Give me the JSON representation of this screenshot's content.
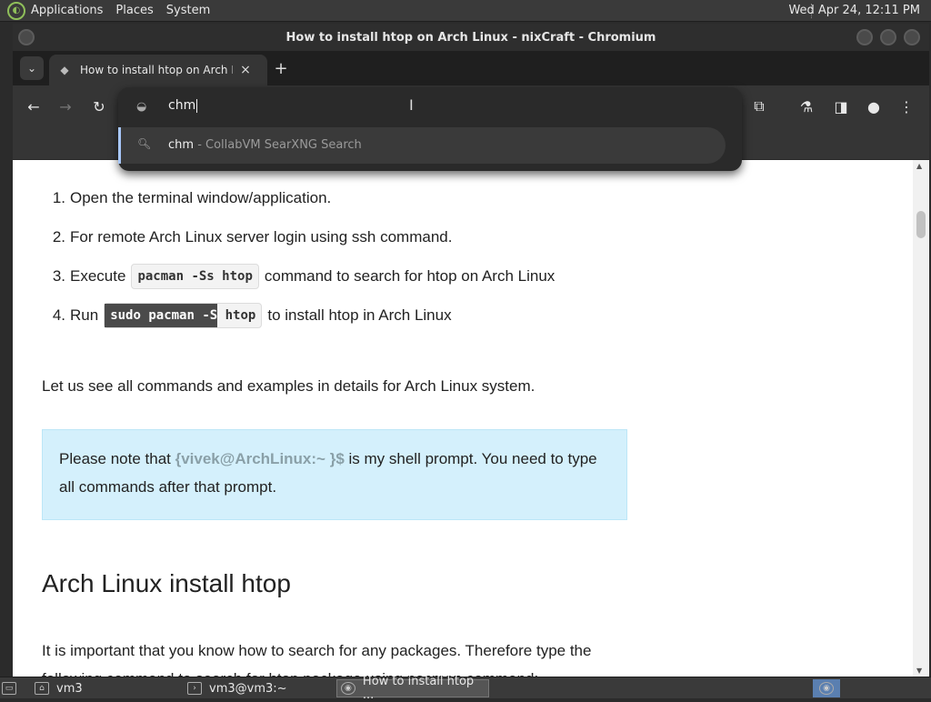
{
  "top_panel": {
    "menus": [
      "Applications",
      "Places",
      "System"
    ],
    "clock": "Wed Apr 24, 12:11 PM"
  },
  "window": {
    "title": "How to install htop on Arch Linux - nixCraft - Chromium"
  },
  "tab": {
    "title": "How to install htop on Arch L",
    "close": "×",
    "new_tab": "+"
  },
  "omnibox": {
    "query": "chm",
    "suggestion": {
      "term": "chm",
      "source": " - CollabVM SearXNG Search"
    }
  },
  "content": {
    "steps": [
      {
        "num": "1.",
        "text": "Open the terminal window/application."
      },
      {
        "num": "2.",
        "text": "For remote Arch Linux server login using ssh command."
      },
      {
        "num": "3.",
        "pre": "Execute",
        "code": "pacman -Ss htop",
        "post": "command to search for htop on Arch Linux"
      },
      {
        "num": "4.",
        "pre": "Run",
        "code_selected": "sudo pacman -S",
        "code_rest": " htop",
        "post": "to install htop in Arch Linux"
      }
    ],
    "intro": "Let us see all commands and examples in details for Arch Linux system.",
    "note": {
      "before": "Please note that ",
      "prompt": "{vivek@ArchLinux:~ }$",
      "after": " is my shell prompt. You need to type all commands after that prompt."
    },
    "heading": "Arch Linux install htop",
    "para": "It is important that you know how to search for any packages. Therefore type the following command to search for htop package using pacman command:"
  },
  "taskbar": {
    "items": [
      "vm3",
      "vm3@vm3:~",
      "How to install htop ..."
    ]
  }
}
